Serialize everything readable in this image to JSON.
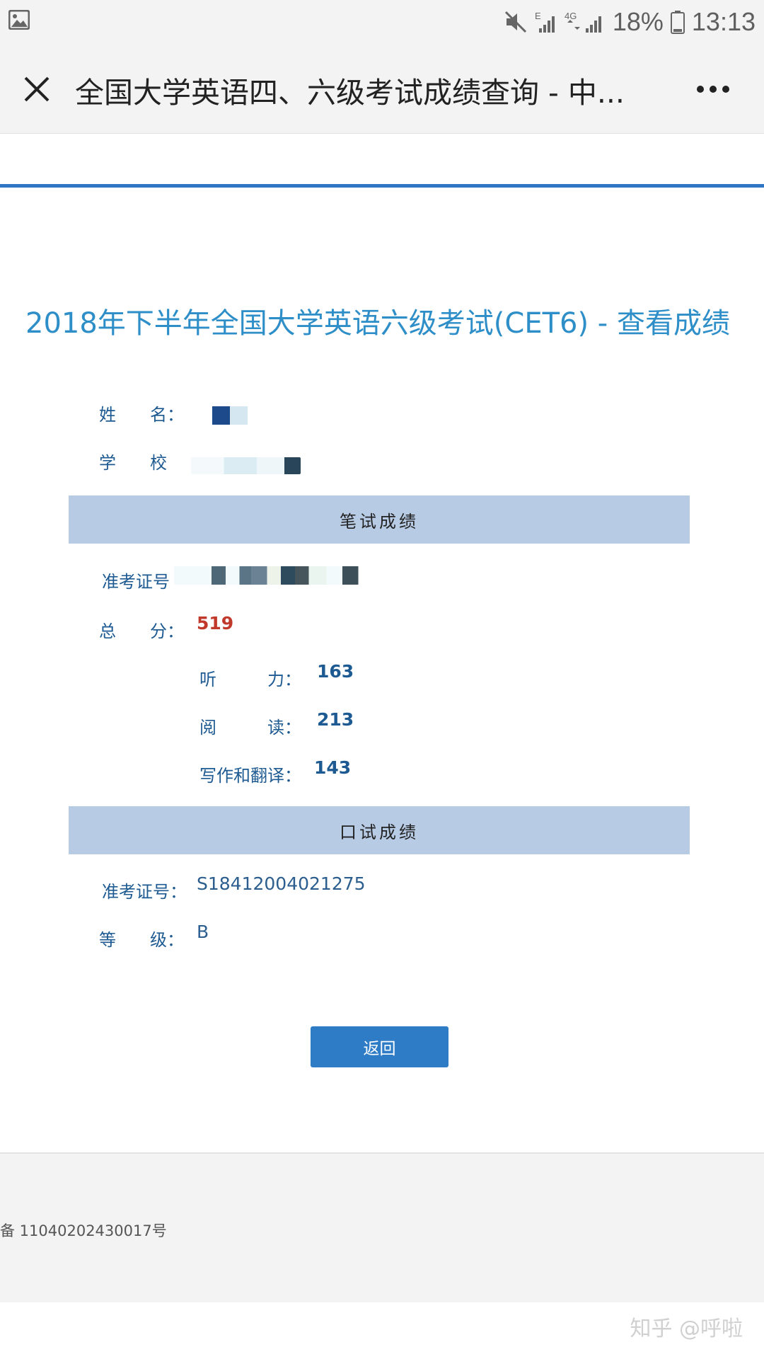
{
  "status_bar": {
    "battery": "18%",
    "time": "13:13",
    "network_type": "4G",
    "signal_label": "E"
  },
  "header": {
    "title": "全国大学英语四、六级考试成绩查询 - 中..."
  },
  "page": {
    "title": "2018年下半年全国大学英语六级考试(CET6) - 查看成绩",
    "info": {
      "name_label": "姓　　名：",
      "school_label": "学　　校"
    },
    "written": {
      "section_label": "笔试成绩",
      "ticket_label": "准考证号",
      "total_label": "总　　分：",
      "total_value": "519",
      "listening_label": "听　　　力：",
      "listening_value": "163",
      "reading_label": "阅　　　读：",
      "reading_value": "213",
      "writing_label": "写作和翻译：",
      "writing_value": "143"
    },
    "oral": {
      "section_label": "口试成绩",
      "ticket_label": "准考证号：",
      "ticket_value": "S18412004021275",
      "grade_label": "等　　级：",
      "grade_value": "B"
    },
    "back_button": "返回"
  },
  "footer": {
    "text": "备 11040202430017号"
  },
  "watermark": "知乎 @呼啦",
  "colors": {
    "accent": "#2f77c5",
    "title": "#2d8ec8",
    "band": "#b7cbe5",
    "total_score": "#c0392b"
  }
}
